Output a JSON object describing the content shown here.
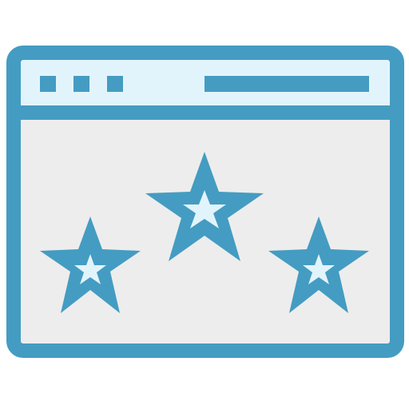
{
  "icon": {
    "name": "website-rating-icon",
    "title_bar_dot_count": 3,
    "star_count": 3,
    "colors": {
      "stroke": "#449CC2",
      "title_bar_fill": "#E2F4FB",
      "content_fill": "#EDEDED",
      "star_fill": "#449CC2",
      "star_inner_fill": "#E2F4FB",
      "background": "#FFFFFF"
    }
  }
}
